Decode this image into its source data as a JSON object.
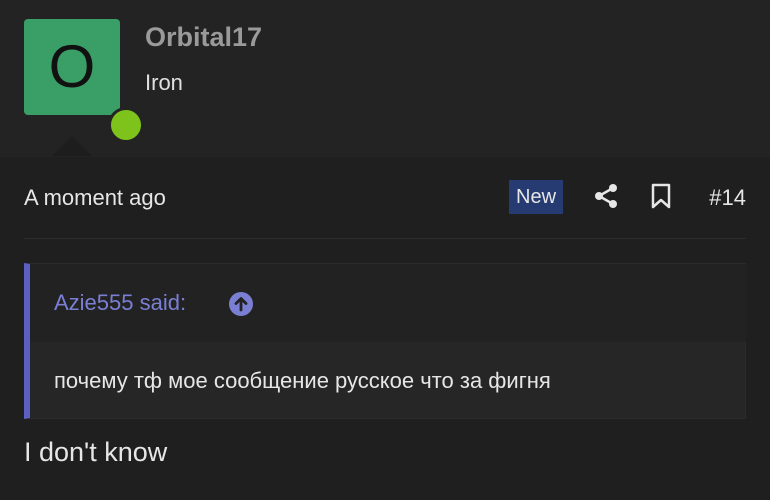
{
  "user": {
    "avatar_letter": "O",
    "name": "Orbital17",
    "title": "Iron",
    "online": true
  },
  "post": {
    "timestamp": "A moment ago",
    "badge": "New",
    "number": "#14",
    "icons": [
      "share-icon",
      "bookmark-icon"
    ]
  },
  "quote": {
    "author_label": "Azie555 said:",
    "text": "почему тф мое сообщение русское что за фигня"
  },
  "reply": {
    "text": "I don't know"
  },
  "colors": {
    "avatar_bg": "#3a9f66",
    "online_dot": "#7dc31c",
    "new_badge": "#273b73",
    "quote_accent": "#5b5fc2"
  }
}
